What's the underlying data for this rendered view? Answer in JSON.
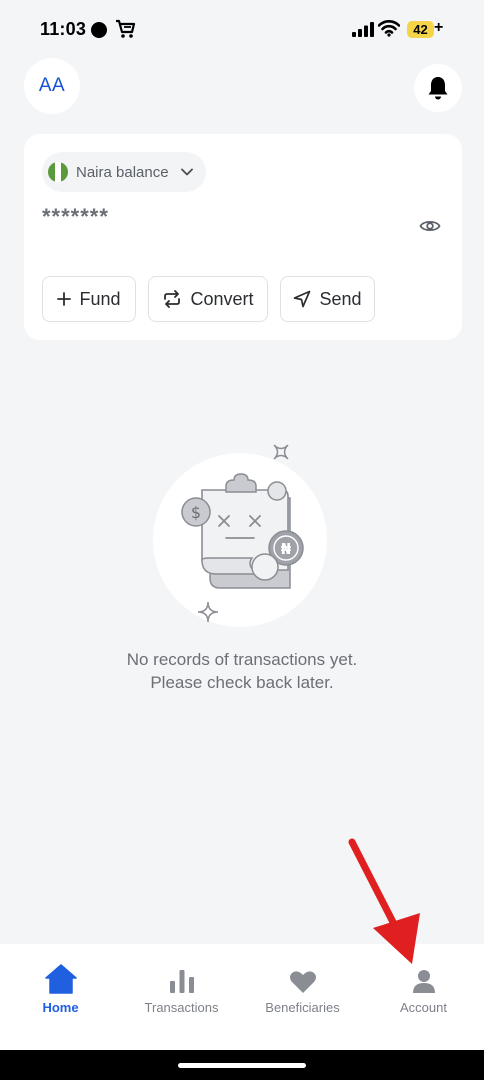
{
  "status_bar": {
    "time": "11:03",
    "battery": "42",
    "battery_suffix": "+"
  },
  "header": {
    "avatar_initials": "AA",
    "notification_icon": "bell-icon"
  },
  "balance_card": {
    "selector_label": "Naira balance",
    "flag_colors": [
      "#5a9a3c",
      "#ffffff",
      "#5a9a3c"
    ],
    "masked_balance": "*******",
    "actions": [
      {
        "label": "Fund",
        "icon": "plus-icon"
      },
      {
        "label": "Convert",
        "icon": "convert-icon"
      },
      {
        "label": "Send",
        "icon": "send-icon"
      }
    ]
  },
  "empty_state": {
    "line1": "No records of transactions yet.",
    "line2": "Please check back later.",
    "illustration_symbols": [
      "$",
      "₦"
    ]
  },
  "bottom_nav": {
    "items": [
      {
        "label": "Home",
        "icon": "home-icon",
        "active": true
      },
      {
        "label": "Transactions",
        "icon": "bar-chart-icon",
        "active": false
      },
      {
        "label": "Beneficiaries",
        "icon": "heart-icon",
        "active": false
      },
      {
        "label": "Account",
        "icon": "person-icon",
        "active": false
      }
    ]
  },
  "colors": {
    "accent": "#1f5fe0",
    "annotation_arrow": "#e02020",
    "background": "#f4f5f7"
  }
}
